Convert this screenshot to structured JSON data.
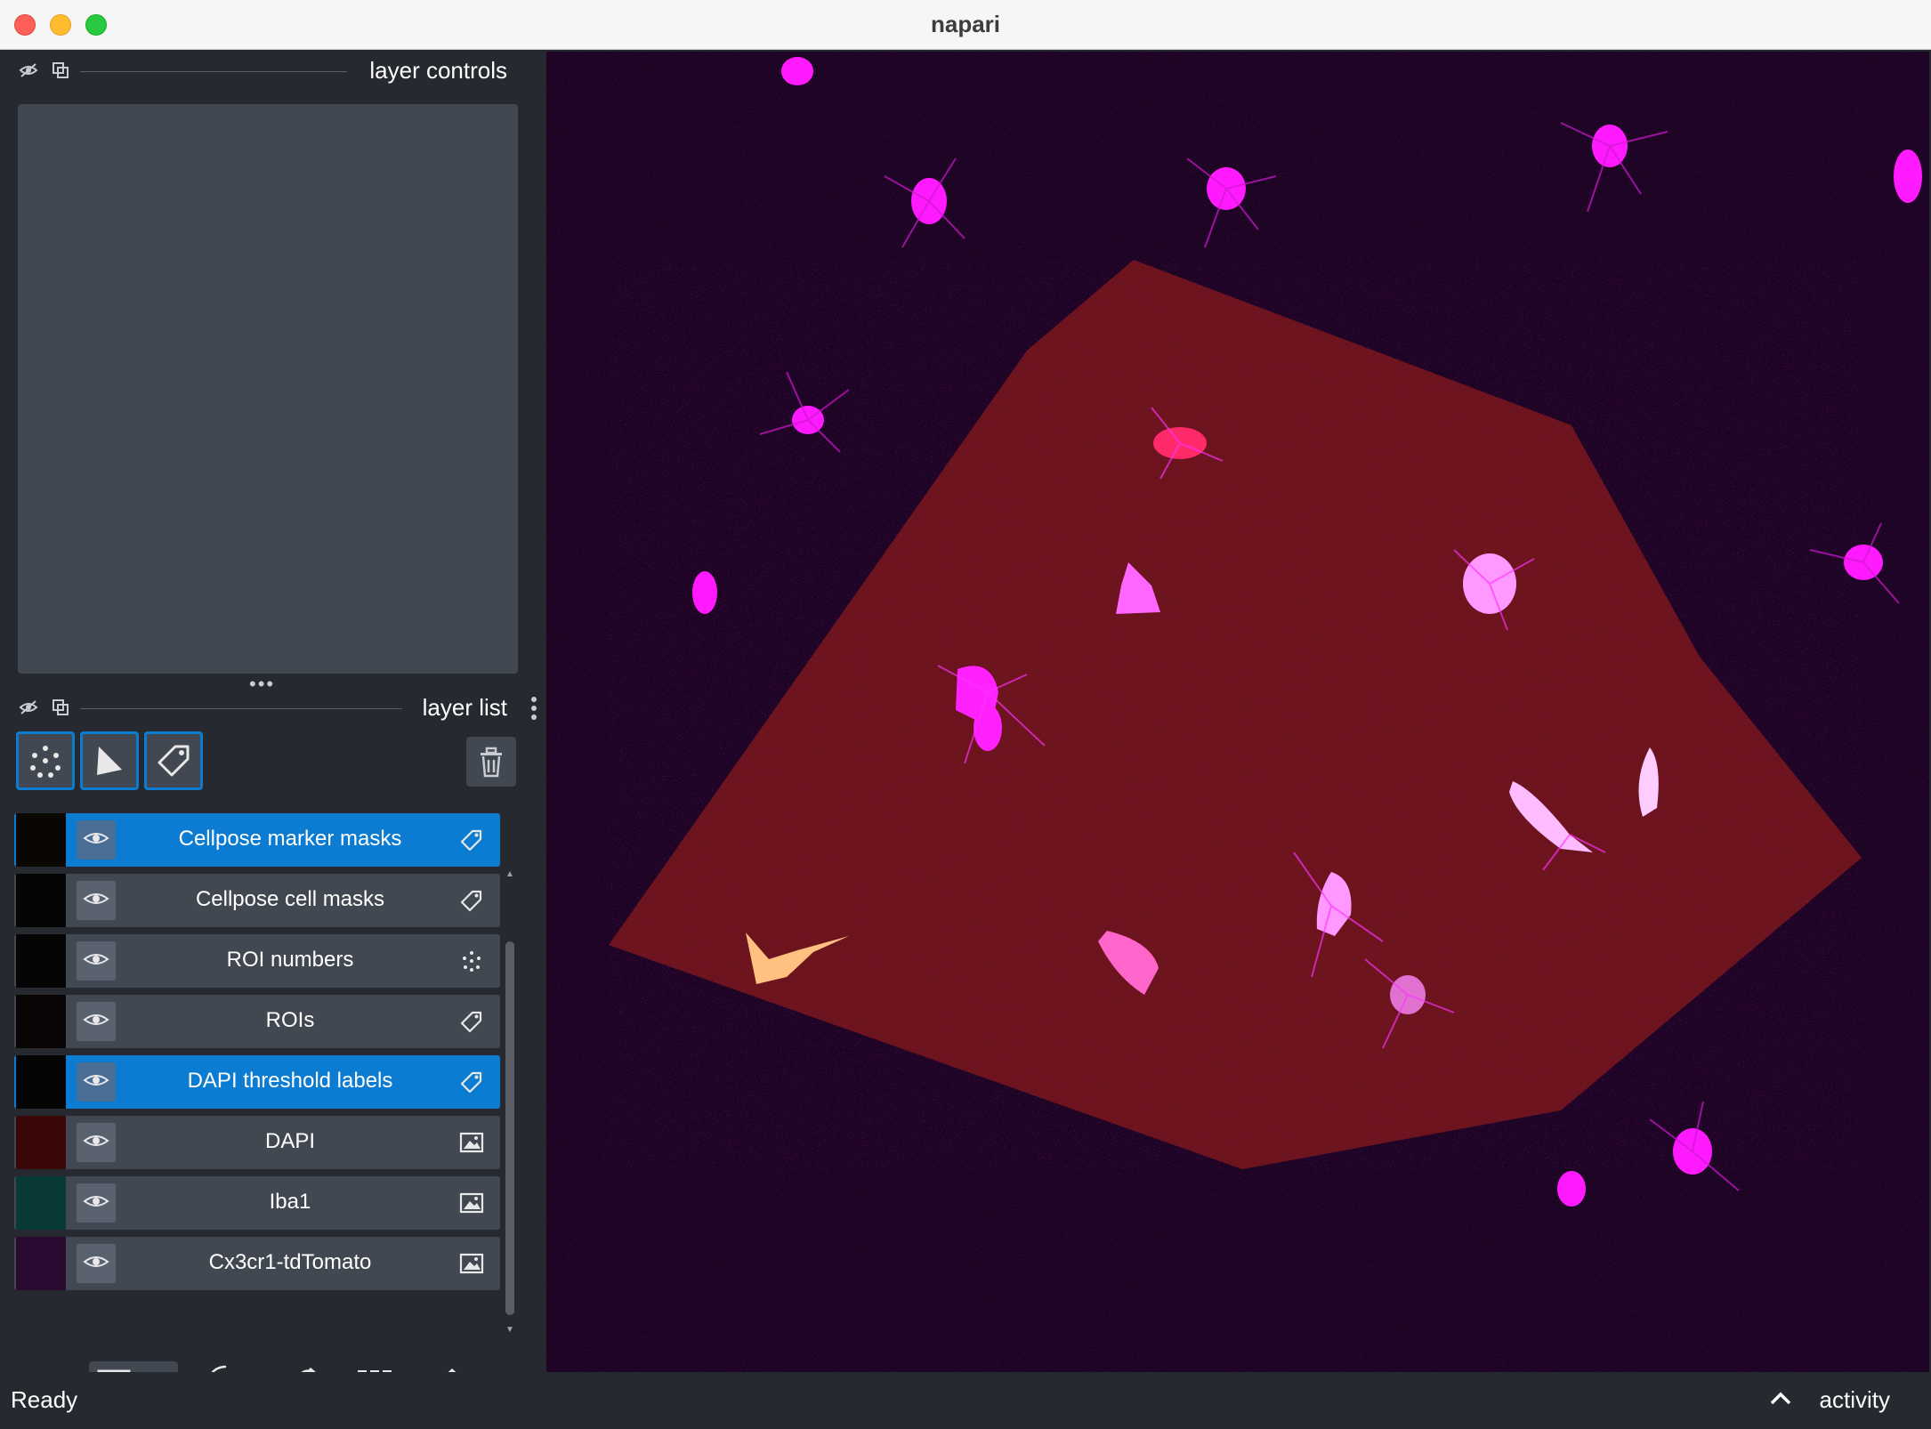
{
  "window": {
    "title": "napari"
  },
  "layer_controls": {
    "title": "layer controls"
  },
  "layer_list": {
    "title": "layer list",
    "tools": [
      {
        "icon": "new-points-icon",
        "label": "new points layer"
      },
      {
        "icon": "new-shapes-icon",
        "label": "new shapes layer"
      },
      {
        "icon": "new-labels-icon",
        "label": "new labels layer"
      }
    ],
    "delete_icon": "trash-icon",
    "layers": [
      {
        "name": "Cellpose marker masks",
        "type": "labels",
        "selected": true,
        "thumb": "#0a0703"
      },
      {
        "name": "Cellpose cell masks",
        "type": "labels",
        "selected": false,
        "thumb": "#050505"
      },
      {
        "name": "ROI numbers",
        "type": "points",
        "selected": false,
        "thumb": "#050505"
      },
      {
        "name": "ROIs",
        "type": "labels",
        "selected": false,
        "thumb": "#0a0505"
      },
      {
        "name": "DAPI threshold labels",
        "type": "labels",
        "selected": true,
        "thumb": "#050505"
      },
      {
        "name": "DAPI",
        "type": "image",
        "selected": false,
        "thumb": "#3a0808"
      },
      {
        "name": "Iba1",
        "type": "image",
        "selected": false,
        "thumb": "#0a3a38"
      },
      {
        "name": "Cx3cr1-tdTomato",
        "type": "image",
        "selected": false,
        "thumb": "#2a0a30"
      }
    ]
  },
  "bottom_buttons": [
    {
      "icon": "console-icon",
      "active": false
    },
    {
      "icon": "ndisplay-toggle-icon",
      "active": true
    },
    {
      "icon": "roll-dims-icon",
      "active": false
    },
    {
      "icon": "transpose-icon",
      "active": false
    },
    {
      "icon": "grid-icon",
      "active": false
    },
    {
      "icon": "home-icon",
      "active": false
    }
  ],
  "status": {
    "text": "Ready",
    "activity_label": "activity"
  },
  "colors": {
    "selected_layer": "#0b7cd1",
    "panel_bg": "#262930",
    "row_bg": "#414851",
    "roi_fill": "#8b1a1a",
    "cell_magenta": "#ff1aff"
  }
}
